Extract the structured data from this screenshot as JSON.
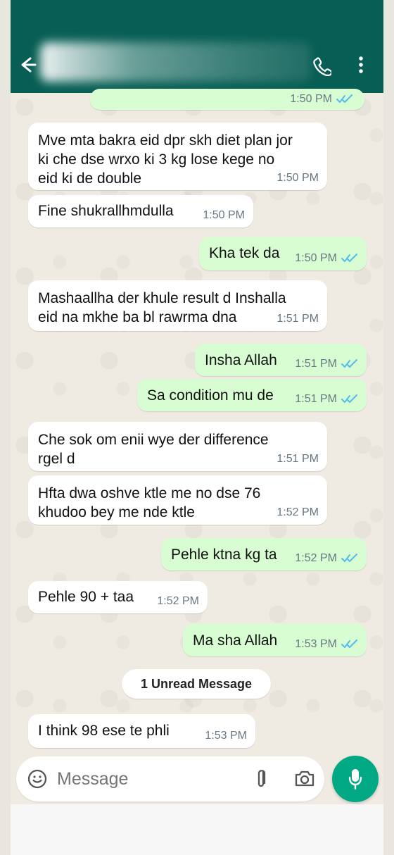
{
  "composer": {
    "placeholder": "Message"
  },
  "messages": [
    {
      "side": "out",
      "text": "",
      "time": "1:50 PM",
      "status": "read"
    },
    {
      "side": "in",
      "text": "Mve mta bakra eid dpr skh diet plan jor\nki che dse wrxo ki 3 kg lose kege no\neid ki de double",
      "time": "1:50 PM"
    },
    {
      "side": "in",
      "text": "Fine shukrallhmdulla",
      "time": "1:50 PM"
    },
    {
      "side": "out",
      "text": "Kha tek da",
      "time": "1:50 PM",
      "status": "read"
    },
    {
      "side": "in",
      "text": "Mashaallha der khule result d Inshalla\neid na mkhe ba bl rawrma dna",
      "time": "1:51 PM"
    },
    {
      "side": "out",
      "text": "Insha Allah",
      "time": "1:51 PM",
      "status": "read"
    },
    {
      "side": "out",
      "text": "Sa condition mu de",
      "time": "1:51 PM",
      "status": "read"
    },
    {
      "side": "in",
      "text": "Che sok om enii wye der difference\nrgel d",
      "time": "1:51 PM"
    },
    {
      "side": "in",
      "text": "Hfta dwa oshve ktle me no dse 76\nkhudoo bey me nde ktle",
      "time": "1:52 PM"
    },
    {
      "side": "out",
      "text": "Pehle ktna kg ta",
      "time": "1:52 PM",
      "status": "read"
    },
    {
      "side": "in",
      "text": "Pehle 90 + taa",
      "time": "1:52 PM"
    },
    {
      "side": "out",
      "text": "Ma sha Allah",
      "time": "1:53 PM",
      "status": "read"
    },
    {
      "side": "in",
      "text": "I think 98 ese te phli",
      "time": "1:53 PM"
    }
  ],
  "unread_label": "1 Unread Message",
  "icons": {
    "back": "arrow-left-icon",
    "call": "phone-icon",
    "menu": "more-vertical-icon",
    "emoji": "emoji-icon",
    "attach": "paperclip-icon",
    "camera": "camera-icon",
    "mic": "mic-icon",
    "read_receipt": "double-check-icon"
  },
  "colors": {
    "app_bar": "#075e54",
    "incoming_bubble": "#ffffff",
    "outgoing_bubble": "#d9fdd3",
    "read_receipt": "#53bdeb",
    "mic_button": "#00a884"
  }
}
